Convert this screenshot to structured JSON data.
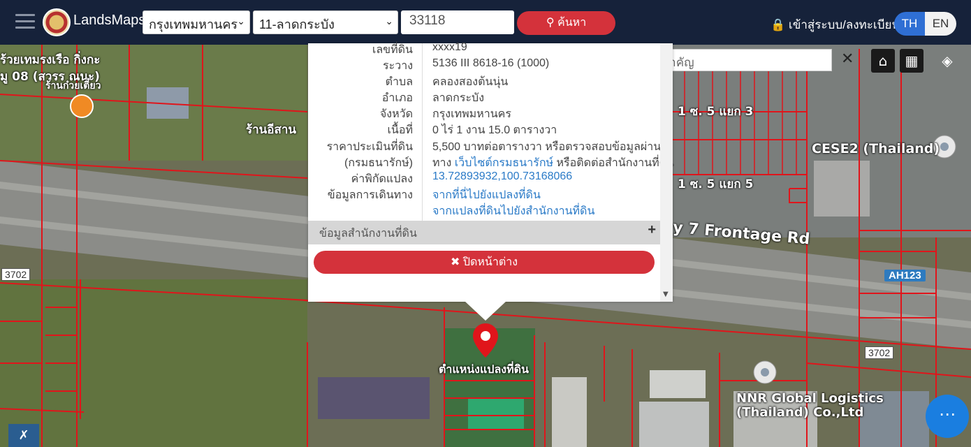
{
  "header": {
    "brand": "LandsMaps",
    "province_select": "กรุงเทพมหานคร",
    "district_select": "11-ลาดกระบัง",
    "parcel_number": "33118",
    "search_label": "ค้นหา",
    "login_label": "เข้าสู่ระบบ/ลงทะเบียน",
    "lang_th": "TH",
    "lang_en": "EN"
  },
  "landmark_search": {
    "placeholder": "ค้นหาสถานที่สำคัญ",
    "close": "✕"
  },
  "popup": {
    "rows": [
      {
        "key": "เลขที่ดิน",
        "value": "xxxx19"
      },
      {
        "key": "ระวาง",
        "value": "5136 III 8618-16 (1000)"
      },
      {
        "key": "ตำบล",
        "value": "คลองสองต้นนุ่น"
      },
      {
        "key": "อำเภอ",
        "value": "ลาดกระบัง"
      },
      {
        "key": "จังหวัด",
        "value": "กรุงเทพมหานคร"
      },
      {
        "key": "เนื้อที่",
        "value": "0 ไร่ 1 งาน 15.0 ตารางวา"
      }
    ],
    "price_key_1": "ราคาประเมินที่ดิน",
    "price_key_2": "(กรมธนารักษ์)",
    "price_value_1": "5,500 บาทต่อตารางวา หรือตรวจสอบข้อมูลผ่าน",
    "price_value_2a": "ทาง ",
    "price_value_2b": "เว็บไซต์กรมธนารักษ์",
    "price_value_2c": " หรือติดต่อสำนักงานที่ดิน",
    "coord_key": "ค่าพิกัดแปลง",
    "coord_value": "13.72893932,100.73168066",
    "travel_key": "ข้อมูลการเดินทาง",
    "travel_link_1": "จากที่นี่ไปยังแปลงที่ดิน",
    "travel_link_2": "จากแปลงที่ดินไปยังสำนักงานที่ดิน",
    "office_section": "ข้อมูลสำนักงานที่ดิน",
    "office_plus": "+",
    "close_button": "ปิดหน้าต่าง"
  },
  "map": {
    "marker_label": "ตำแหน่งแปลงที่ดิน",
    "labels": {
      "shop": "ร้านอีสาน",
      "top_left_1": "ร้วยเทมรงเรือ กิ่งกะ",
      "top_left_2": "มู 08 (สวรร ณนะ)",
      "top_left_3": "ร้านก๋วยเตี๋ยว",
      "soi_1": "1 ซ. 5 แยก 3",
      "soi_2": "1 ซ. 5 แยก 5",
      "cese": "CESE2 (Thailand)",
      "frontage": "y 7 Frontage Rd",
      "nnr_1": "NNR Global Logistics",
      "nnr_2": "(Thailand) Co.,Ltd"
    },
    "badges": {
      "road_3702_left": "3702",
      "road_3702_right": "3702",
      "ah123": "AH123"
    }
  },
  "colors": {
    "header_bg": "#16223a",
    "accent_red": "#d4323b",
    "lang_active": "#2f6fd4",
    "link": "#2a7ac7",
    "parcel_line": "#e0151b"
  }
}
